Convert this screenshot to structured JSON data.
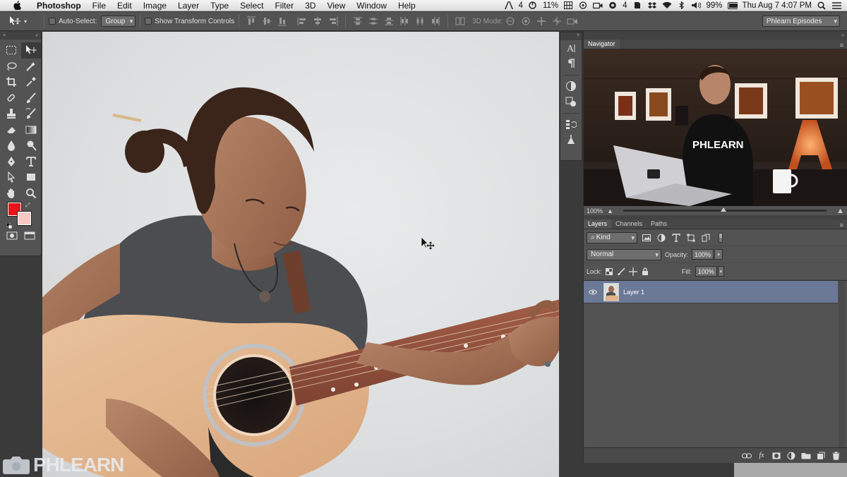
{
  "menubar": {
    "app": "Photoshop",
    "items": [
      "File",
      "Edit",
      "Image",
      "Layer",
      "Type",
      "Select",
      "Filter",
      "3D",
      "View",
      "Window",
      "Help"
    ],
    "status": {
      "adobe_badge": "4",
      "cpu": "11%",
      "notif_count": "4",
      "battery": "99%",
      "datetime": "Thu Aug 7  4:07 PM"
    }
  },
  "options_bar": {
    "auto_select_label": "Auto-Select:",
    "auto_select_value": "Group",
    "show_transform_label": "Show Transform Controls",
    "mode3d_label": "3D Mode:",
    "workspace": "Phlearn Episodes"
  },
  "colors": {
    "foreground": "#e8141c",
    "background": "#f7c9c2",
    "layer_selected": "#6b7896"
  },
  "navigator": {
    "tab": "Navigator",
    "zoom": "100%",
    "zoom_fraction": 0.48,
    "thumb_text": "PHLEARN"
  },
  "layers_panel": {
    "tabs": [
      "Layers",
      "Channels",
      "Paths"
    ],
    "filter_kind": "Kind",
    "blend_mode": "Normal",
    "opacity_label": "Opacity:",
    "opacity": "100%",
    "lock_label": "Lock:",
    "fill_label": "Fill:",
    "fill": "100%",
    "layers": [
      {
        "name": "Layer 1",
        "visible": true,
        "selected": true
      }
    ]
  },
  "watermark": {
    "text": "PHLEARN"
  }
}
